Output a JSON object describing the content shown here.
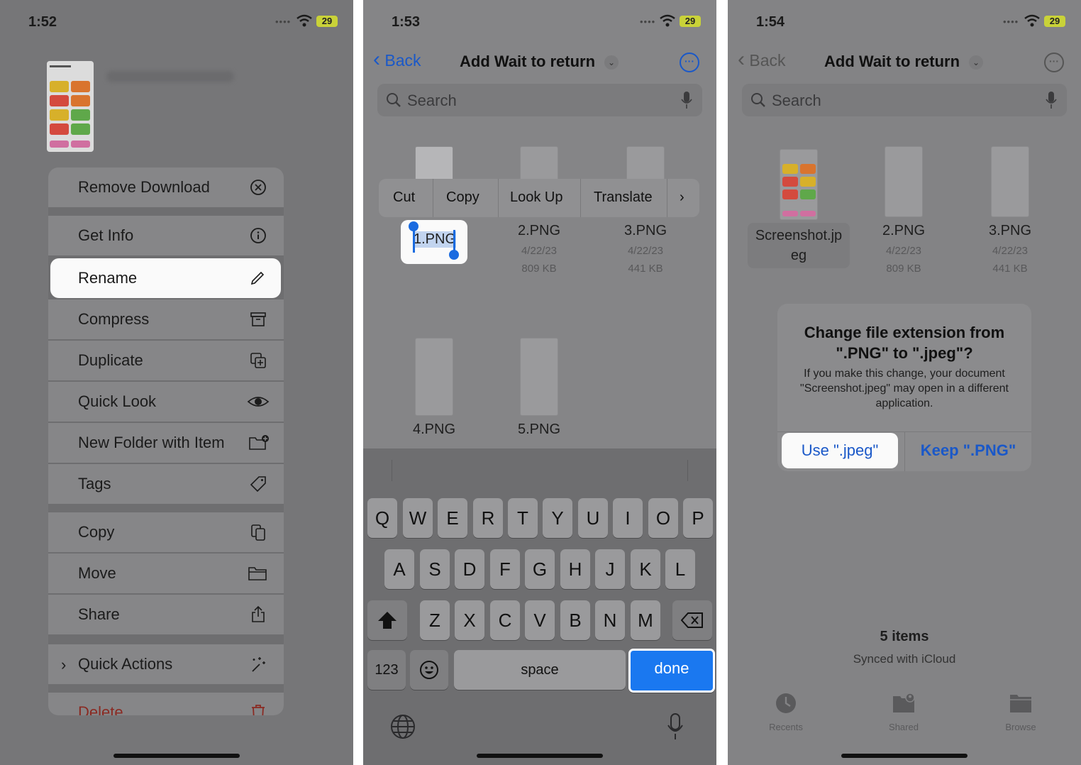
{
  "screen1": {
    "time": "1:52",
    "battery": "29",
    "menu": [
      {
        "label": "Remove Download",
        "icon": "x-circle-icon"
      },
      {
        "label": "Get Info",
        "icon": "info-circle-icon"
      },
      {
        "label": "Rename",
        "icon": "pencil-icon",
        "selected": true
      },
      {
        "label": "Compress",
        "icon": "archive-box-icon"
      },
      {
        "label": "Duplicate",
        "icon": "duplicate-icon"
      },
      {
        "label": "Quick Look",
        "icon": "eye-icon"
      },
      {
        "label": "New Folder with Item",
        "icon": "folder-plus-icon"
      },
      {
        "label": "Tags",
        "icon": "tag-icon"
      },
      {
        "label": "Copy",
        "icon": "copy-icon"
      },
      {
        "label": "Move",
        "icon": "folder-icon"
      },
      {
        "label": "Share",
        "icon": "share-icon"
      },
      {
        "label": "Quick Actions",
        "icon": "sparkles-icon"
      },
      {
        "label": "Delete",
        "icon": "trash-icon"
      }
    ]
  },
  "screen2": {
    "time": "1:53",
    "battery": "29",
    "back": "Back",
    "title": "Add Wait to return",
    "search_placeholder": "Search",
    "edit_menu": [
      "Cut",
      "Copy",
      "Look Up",
      "Translate"
    ],
    "rename_value": "1.PNG",
    "files": [
      {
        "name": "2.PNG",
        "date": "4/22/23",
        "size": "809 KB"
      },
      {
        "name": "3.PNG",
        "date": "4/22/23",
        "size": "441 KB"
      },
      {
        "name": "4.PNG"
      },
      {
        "name": "5.PNG"
      }
    ],
    "keyboard": {
      "row1": [
        "Q",
        "W",
        "E",
        "R",
        "T",
        "Y",
        "U",
        "I",
        "O",
        "P"
      ],
      "row2": [
        "A",
        "S",
        "D",
        "F",
        "G",
        "H",
        "J",
        "K",
        "L"
      ],
      "row3": [
        "Z",
        "X",
        "C",
        "V",
        "B",
        "N",
        "M"
      ],
      "numbers": "123",
      "space": "space",
      "done": "done"
    }
  },
  "screen3": {
    "time": "1:54",
    "battery": "29",
    "back": "Back",
    "title": "Add Wait to return",
    "search_placeholder": "Search",
    "files": [
      {
        "name": "Screenshot.jp\neg"
      },
      {
        "name": "2.PNG",
        "date": "4/22/23",
        "size": "809 KB"
      },
      {
        "name": "3.PNG",
        "date": "4/22/23",
        "size": "441 KB"
      }
    ],
    "alert": {
      "title": "Change file extension from \".PNG\" to \".jpeg\"?",
      "message": "If you make this change, your document \"Screenshot.jpeg\" may open in a different application.",
      "use": "Use \".jpeg\"",
      "keep": "Keep \".PNG\""
    },
    "count": "5 items",
    "synced": "Synced with iCloud",
    "tabs": [
      "Recents",
      "Shared",
      "Browse"
    ]
  },
  "colors": {
    "accent": "#1a78f0",
    "link": "#1a58c8",
    "destructive": "#8a2a22"
  }
}
